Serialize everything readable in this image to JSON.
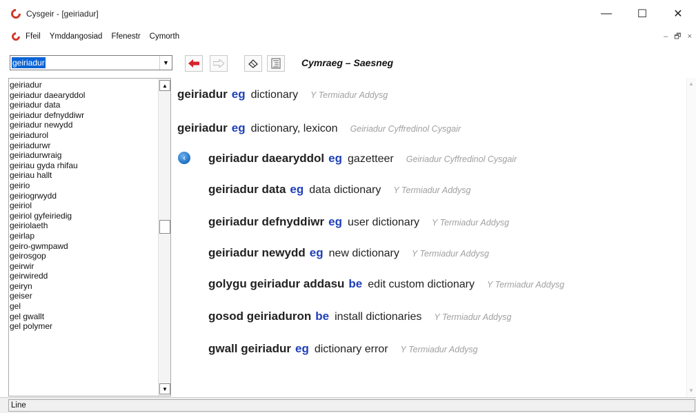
{
  "window": {
    "title": "Cysgeir - [geiriadur]",
    "controls": {
      "minimize": "—",
      "maximize": "☐",
      "close": "✕"
    }
  },
  "menu": {
    "items": [
      "Ffeil",
      "Ymddangosiad",
      "Ffenestr",
      "Cymorth"
    ],
    "mdi": {
      "minimize": "–",
      "restore": "🗗",
      "close": "×"
    }
  },
  "toolbar": {
    "search_value": "geiriadur",
    "title": "Cymraeg – Saesneg",
    "icons": [
      "back-arrow-icon",
      "forward-arrow-icon",
      "eraser-icon",
      "list-icon"
    ]
  },
  "word_list": [
    "geiriadur",
    "geiriadur daearyddol",
    "geiriadur data",
    "geiriadur defnyddiwr",
    "geiriadur newydd",
    "geiriadurol",
    "geiriadurwr",
    "geiriadurwraig",
    "geiriau gyda rhifau",
    "geiriau hallt",
    "geirio",
    "geiriogrwydd",
    "geiriol",
    "geiriol gyfeiriedig",
    "geiriolaeth",
    "geirlap",
    "geiro-gwmpawd",
    "geirosgop",
    "geirwir",
    "geirwiredd",
    "geiryn",
    "geiser",
    "gel",
    "gel gwallt",
    "gel polymer"
  ],
  "results": [
    {
      "head": "geiriadur",
      "pos": "eg",
      "trans": "dictionary",
      "source": "Y Termiadur Addysg"
    },
    {
      "head": "geiriadur",
      "pos": "eg",
      "trans": "dictionary, lexicon",
      "source": "Geiriadur Cyffredinol Cysgair"
    },
    {
      "head": "geiriadur daearyddol",
      "pos": "eg",
      "trans": "gazetteer",
      "source": "Geiriadur Cyffredinol Cysgair"
    },
    {
      "head": "geiriadur data",
      "pos": "eg",
      "trans": "data dictionary",
      "source": "Y Termiadur Addysg"
    },
    {
      "head": "geiriadur defnyddiwr",
      "pos": "eg",
      "trans": "user dictionary",
      "source": "Y Termiadur Addysg"
    },
    {
      "head": "geiriadur newydd",
      "pos": "eg",
      "trans": "new dictionary",
      "source": "Y Termiadur Addysg"
    },
    {
      "head": "golygu geiriadur addasu",
      "pos": "be",
      "trans": "edit custom dictionary",
      "source": "Y Termiadur Addysg"
    },
    {
      "head": "gosod geiriaduron",
      "pos": "be",
      "trans": "install dictionaries",
      "source": "Y Termiadur Addysg"
    },
    {
      "head": "gwall geiriadur",
      "pos": "eg",
      "trans": "dictionary error",
      "source": "Y Termiadur Addysg"
    }
  ],
  "status": {
    "text": "Line"
  },
  "colors": {
    "pos": "#1f3fb8",
    "source": "#a0a0a0",
    "back_arrow": "#d8232a",
    "selection": "#0a64d6"
  }
}
